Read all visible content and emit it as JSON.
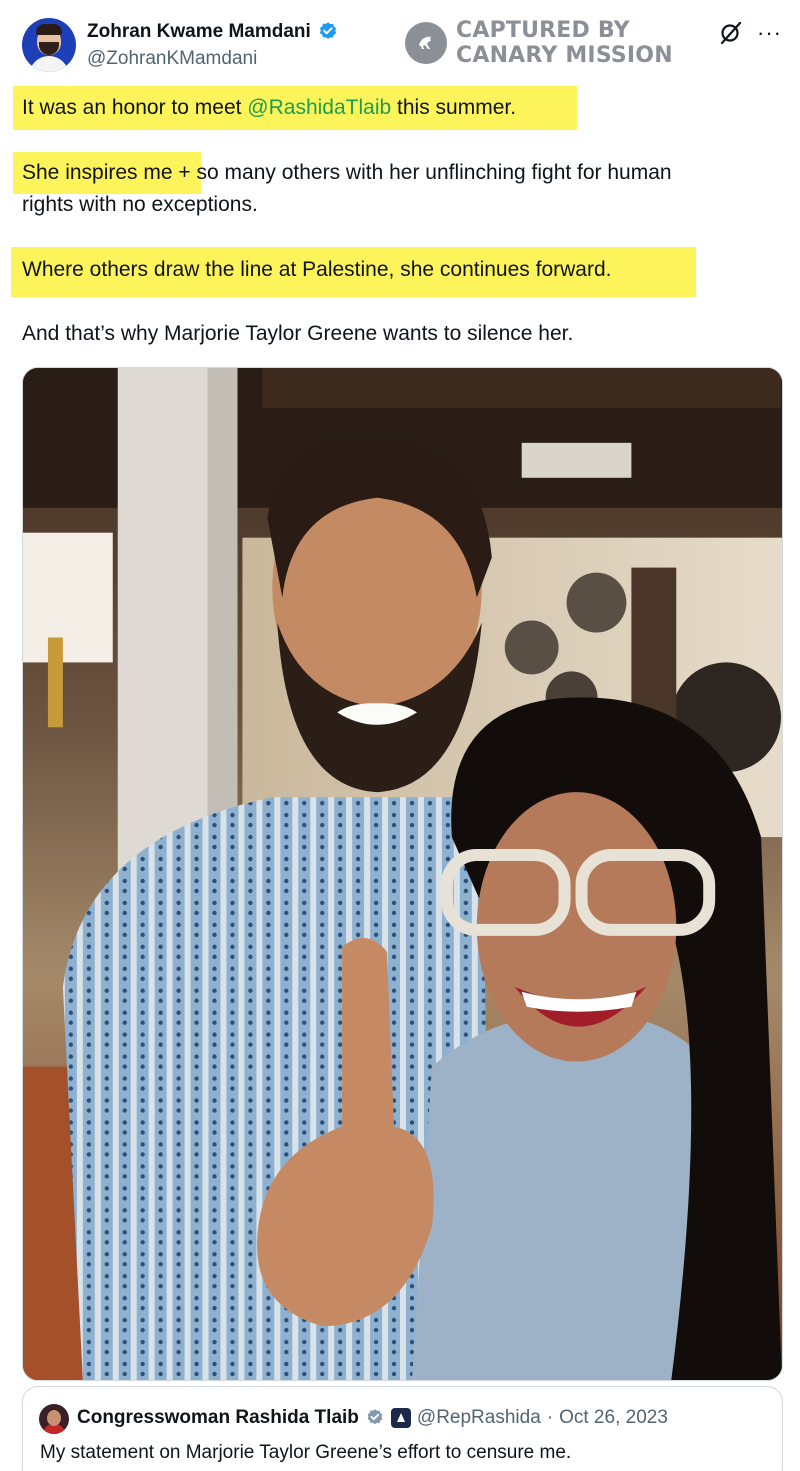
{
  "author": {
    "display_name": "Zohran Kwame Mamdani",
    "handle": "@ZohranKMamdani"
  },
  "watermark": {
    "line1": "CAPTURED BY",
    "line2": "CANARY MISSION"
  },
  "icons": {
    "verified": "verified-badge-icon",
    "grok": "grok-icon",
    "more": "more-options-icon"
  },
  "tweet": {
    "p1_prefix": "It was an honor to meet ",
    "p1_mention": "@RashidaTlaib",
    "p1_suffix": " this summer.",
    "p2_highlight": "She inspires me +",
    "p2_rest": " so many others with her unflinching fight for human",
    "p2_line2": "rights with no exceptions.",
    "p3": "Where others draw the line at Palestine, she continues forward.",
    "p4": "And that’s why Marjorie Taylor Greene wants to silence her."
  },
  "photo": {
    "alt": "Photo"
  },
  "quote": {
    "display_name": "Congresswoman Rashida Tlaib",
    "handle": "@RepRashida",
    "separator": "·",
    "date": "Oct 26, 2023",
    "text": "My statement on Marjorie Taylor Greene’s effort to censure me."
  },
  "colors": {
    "highlight": "#fdf45c",
    "mention_in_highlight": "#1e9e4e",
    "verified_blue": "#1d9bf0",
    "muted": "#536471",
    "watermark_gray": "#8a9096"
  }
}
